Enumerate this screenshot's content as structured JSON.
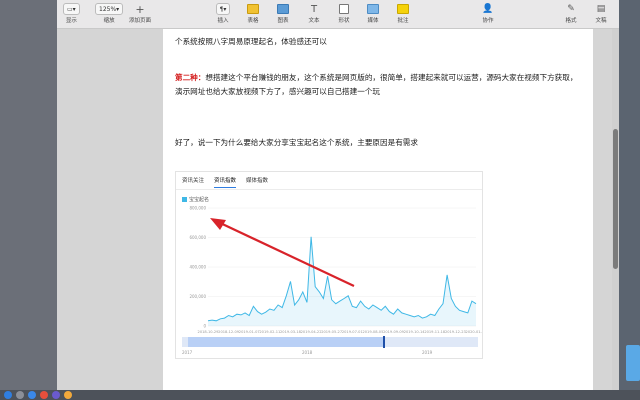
{
  "toolbar": {
    "buttons": [
      {
        "label": "显示",
        "icon": "sidebar-icon"
      },
      {
        "label": "缩放",
        "value": "125%",
        "icon": "zoom-icon"
      },
      {
        "label": "添加页面",
        "icon": "plus-icon"
      },
      {
        "label": "插入",
        "icon": "paragraph-icon"
      },
      {
        "label": "表格",
        "icon": "table-icon"
      },
      {
        "label": "图表",
        "icon": "chart-icon"
      },
      {
        "label": "文本",
        "icon": "text-icon"
      },
      {
        "label": "形状",
        "icon": "shape-icon"
      },
      {
        "label": "媒体",
        "icon": "media-icon"
      },
      {
        "label": "批注",
        "icon": "comment-icon"
      },
      {
        "label": "协作",
        "icon": "collaborate-icon"
      },
      {
        "label": "格式",
        "icon": "format-icon"
      },
      {
        "label": "文稿",
        "icon": "document-icon"
      }
    ]
  },
  "document": {
    "para1_line2": "个系统按照八字周易原理起名，体验感还可以",
    "para2_label": "第二种：",
    "para2_text": "想搭建这个平台赚钱的朋友，这个系统是网页版的，很简单，搭建起来就可以运营，源码大家在视频下方获取，演示网址也给大家放视频下方了，感兴趣可以自己搭建一个玩",
    "para3": "好了，说一下为什么要给大家分享宝宝起名这个系统，主要原因是有需求"
  },
  "embedded": {
    "tabs": [
      "资讯关注",
      "资讯指数",
      "媒体指数"
    ],
    "active_tab": 1,
    "legend": "宝宝起名",
    "series_color": "#3fb8e6",
    "arrow_color": "#d8232a"
  },
  "chart_data": {
    "type": "area",
    "yticks": [
      "800,000",
      "600,000",
      "400,000",
      "200,000",
      "0"
    ],
    "xticks": [
      "2018-10-29",
      "2018-12-09",
      "2019-01-07",
      "2019-02-11",
      "2019-03-18",
      "2019-04-22",
      "2019-05-27",
      "2019-07-01",
      "2019-08-05",
      "2019-09-09",
      "2019-10-14",
      "2019-11-18",
      "2019-12-23",
      "2020-01-27"
    ],
    "values": [
      40,
      45,
      40,
      55,
      60,
      80,
      70,
      90,
      85,
      100,
      80,
      150,
      110,
      90,
      105,
      130,
      120,
      160,
      140,
      230,
      340,
      160,
      200,
      260,
      180,
      680,
      300,
      260,
      210,
      380,
      200,
      170,
      190,
      210,
      230,
      150,
      140,
      190,
      150,
      130,
      160,
      140,
      120,
      150,
      110,
      90,
      130,
      100,
      90,
      80,
      70,
      80,
      60,
      70,
      90,
      80,
      130,
      170,
      390,
      210,
      150,
      120,
      110,
      100,
      190,
      170
    ],
    "ylim": [
      0,
      900000
    ],
    "scroller": {
      "start": 0.02,
      "end": 0.68,
      "mid_labels": [
        "2017",
        "2018",
        "2019"
      ]
    }
  }
}
